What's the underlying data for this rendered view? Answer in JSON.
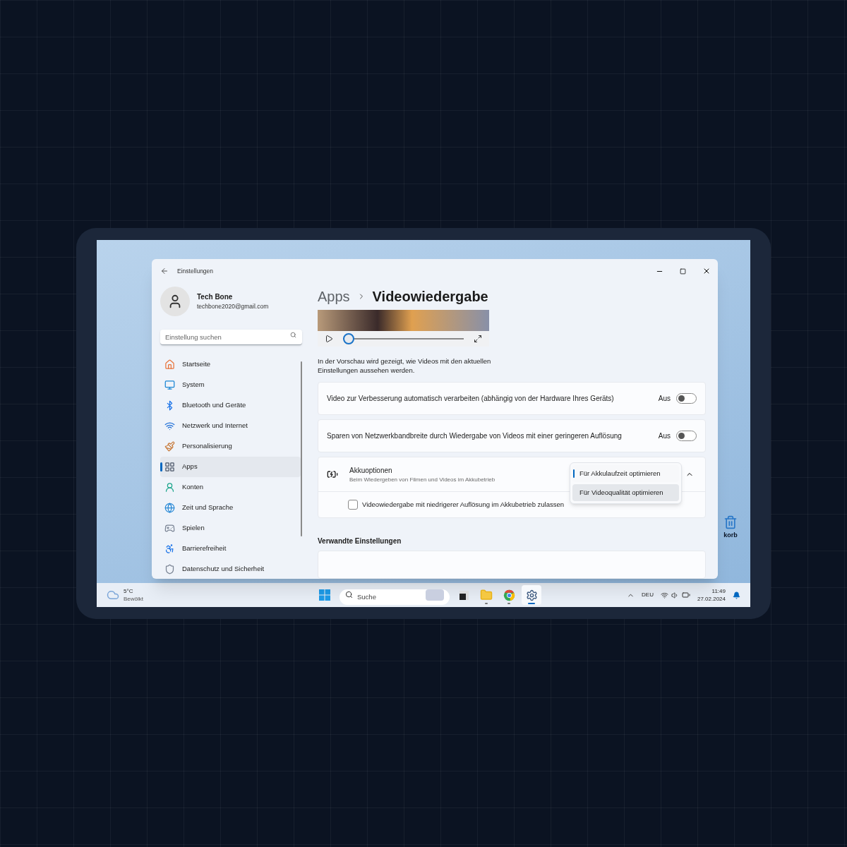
{
  "window": {
    "title": "Einstellungen"
  },
  "profile": {
    "name": "Tech Bone",
    "email": "techbone2020@gmail.com"
  },
  "search": {
    "placeholder": "Einstellung suchen"
  },
  "nav": [
    {
      "label": "Startseite",
      "selected": false
    },
    {
      "label": "System",
      "selected": false
    },
    {
      "label": "Bluetooth und Geräte",
      "selected": false
    },
    {
      "label": "Netzwerk und Internet",
      "selected": false
    },
    {
      "label": "Personalisierung",
      "selected": false
    },
    {
      "label": "Apps",
      "selected": true
    },
    {
      "label": "Konten",
      "selected": false
    },
    {
      "label": "Zeit und Sprache",
      "selected": false
    },
    {
      "label": "Spielen",
      "selected": false
    },
    {
      "label": "Barrierefreiheit",
      "selected": false
    },
    {
      "label": "Datenschutz und Sicherheit",
      "selected": false
    }
  ],
  "breadcrumb": {
    "parent": "Apps",
    "current": "Videowiedergabe"
  },
  "video_preview": {
    "level": 0
  },
  "description": "In der Vorschau wird gezeigt, wie Videos mit den aktuellen Einstellungen aussehen werden.",
  "settings": [
    {
      "kind": "toggle",
      "label": "Video zur Verbesserung automatisch verarbeiten (abhängig von der Hardware Ihres Geräts)",
      "state_label": "Aus",
      "on": false
    },
    {
      "kind": "toggle",
      "label": "Sparen von Netzwerkbandbreite durch Wiedergabe von Videos mit einer geringeren Auflösung",
      "state_label": "Aus",
      "on": false
    },
    {
      "kind": "expander",
      "title": "Akkuoptionen",
      "subtitle": "Beim Wiedergeben von Filmen und Videos im Akkubetrieb",
      "expanded": true,
      "options": [
        {
          "label": "Für Akkulaufzeit optimieren",
          "selected": true
        },
        {
          "label": "Für Videoqualität optimieren",
          "selected": false
        }
      ],
      "children": [
        {
          "kind": "checkbox",
          "label": "Videowiedergabe mit niedrigerer Auflösung im Akkubetrieb zulassen",
          "checked": false
        }
      ]
    }
  ],
  "related": {
    "title": "Verwandte Einstellungen"
  },
  "desktop_icons": [
    {
      "label": "korb"
    }
  ],
  "taskbar": {
    "weather": {
      "temp": "5°C",
      "condition": "Bewölkt"
    },
    "search": {
      "placeholder": "Suche"
    },
    "apps": [
      {
        "running": false,
        "selected": false
      },
      {
        "running": true,
        "selected": false
      },
      {
        "running": true,
        "selected": false
      },
      {
        "running": true,
        "selected": true
      }
    ],
    "language": "DEU",
    "time": "11:49",
    "date": "27.02.2024"
  }
}
